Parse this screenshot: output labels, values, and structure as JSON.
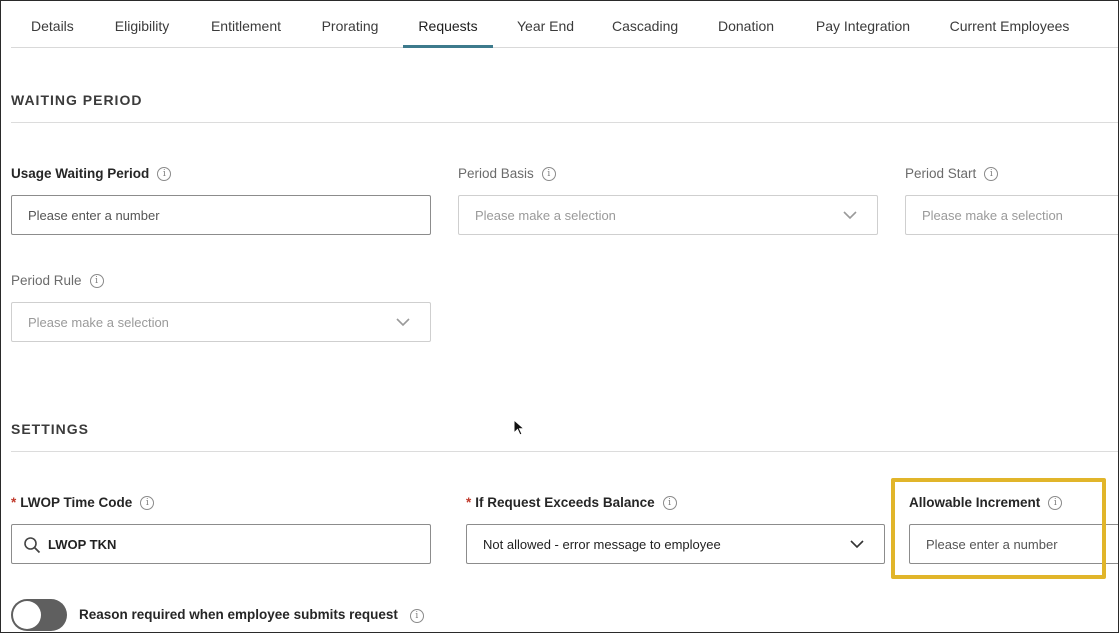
{
  "tabs": [
    {
      "label": "Details",
      "active": false
    },
    {
      "label": "Eligibility",
      "active": false
    },
    {
      "label": "Entitlement",
      "active": false
    },
    {
      "label": "Prorating",
      "active": false
    },
    {
      "label": "Requests",
      "active": true
    },
    {
      "label": "Year End",
      "active": false
    },
    {
      "label": "Cascading",
      "active": false
    },
    {
      "label": "Donation",
      "active": false
    },
    {
      "label": "Pay Integration",
      "active": false
    },
    {
      "label": "Current Employees",
      "active": false
    }
  ],
  "waiting_period": {
    "title": "WAITING PERIOD",
    "usage_waiting_period": {
      "label": "Usage Waiting Period",
      "placeholder": "Please enter a number"
    },
    "period_basis": {
      "label": "Period Basis",
      "placeholder": "Please make a selection"
    },
    "period_start": {
      "label": "Period Start",
      "placeholder": "Please make a selection"
    },
    "period_rule": {
      "label": "Period Rule",
      "placeholder": "Please make a selection"
    }
  },
  "settings": {
    "title": "SETTINGS",
    "required_marker": "*",
    "lwop_time_code": {
      "label": "LWOP Time Code",
      "value": "LWOP TKN"
    },
    "if_request_exceeds_balance": {
      "label": "If Request Exceeds Balance",
      "value": "Not allowed - error message to employee"
    },
    "allowable_increment": {
      "label": "Allowable Increment",
      "placeholder": "Please enter a number"
    },
    "reason_required": {
      "label": "Reason required when employee submits request",
      "enabled": false
    }
  },
  "colors": {
    "active_tab": "#3d7a8c",
    "highlight": "#e1b52a",
    "required": "#c0392b"
  },
  "icons": {
    "info": "info-icon",
    "chevron": "chevron-down-icon",
    "search": "search-icon"
  }
}
